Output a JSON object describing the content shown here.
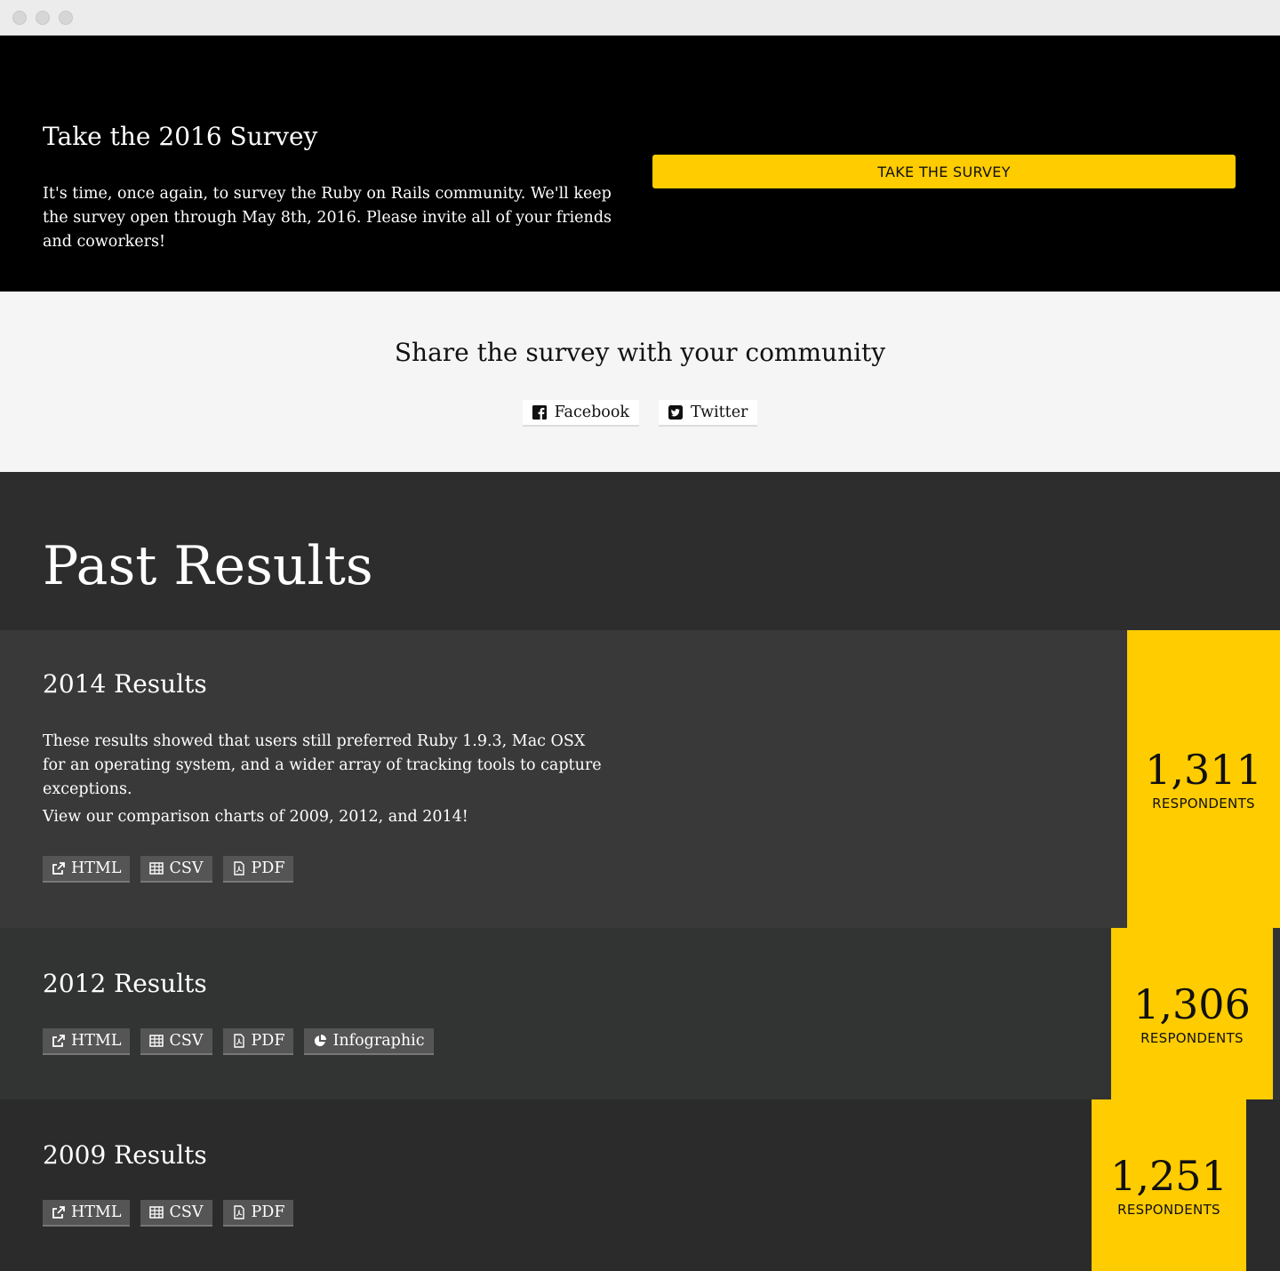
{
  "hero": {
    "title": "Take the 2016 Survey",
    "body": "It's time, once again, to survey the Ruby on Rails community. We'll keep the survey open through May 8th, 2016. Please invite all of your friends and coworkers!",
    "cta_label": "TAKE THE SURVEY"
  },
  "share": {
    "title": "Share the survey with your community",
    "buttons": [
      {
        "label": "Facebook",
        "icon": "facebook-icon"
      },
      {
        "label": "Twitter",
        "icon": "twitter-icon"
      }
    ]
  },
  "past": {
    "title": "Past Results",
    "results": [
      {
        "title": "2014 Results",
        "paragraphs": [
          "These results showed that users still preferred Ruby 1.9.3, Mac OSX for an operating system, and a wider array of tracking tools to capture exceptions.",
          "View our comparison charts of 2009, 2012, and 2014!"
        ],
        "buttons": [
          "HTML",
          "CSV",
          "PDF"
        ],
        "count": "1,311",
        "count_label": "RESPONDENTS"
      },
      {
        "title": "2012 Results",
        "buttons": [
          "HTML",
          "CSV",
          "PDF",
          "Infographic"
        ],
        "count": "1,306",
        "count_label": "RESPONDENTS"
      },
      {
        "title": "2009 Results",
        "buttons": [
          "HTML",
          "CSV",
          "PDF"
        ],
        "count": "1,251",
        "count_label": "RESPONDENTS"
      }
    ]
  },
  "colors": {
    "accent": "#ffcc00",
    "hero_bg": "#000000",
    "share_bg": "#f5f5f5"
  }
}
